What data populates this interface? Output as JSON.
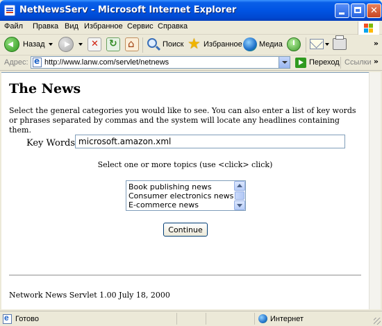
{
  "window": {
    "title": "NetNewsServ - Microsoft Internet Explorer"
  },
  "menu": {
    "items": [
      "Файл",
      "Правка",
      "Вид",
      "Избранное",
      "Сервис",
      "Справка"
    ]
  },
  "toolbar": {
    "back_label": "Назад",
    "search_label": "Поиск",
    "favorites_label": "Избранное",
    "media_label": "Медиа",
    "overflow": "»"
  },
  "address": {
    "label": "Адрес:",
    "url": "http://www.lanw.com/servlet/netnews",
    "go_label": "Переход",
    "links_label": "Ссылки",
    "links_overflow": "»"
  },
  "page": {
    "heading": "The News",
    "intro": "Select the general categories you would like to see. You can also enter a list of key words or phrases separated by commas and the system will locate any headlines containing them.",
    "keywords_label": "Key Words:",
    "keywords_value": "microsoft.amazon.xml",
    "topics_label": "Select one or more topics (use <click> click)",
    "topics": [
      "Book publishing news",
      "Consumer electronics news",
      "E-commerce news"
    ],
    "continue_label": "Continue",
    "footer": "Network News Servlet 1.00 July 18, 2000"
  },
  "status": {
    "text": "Готово",
    "zone": "Интернет"
  }
}
